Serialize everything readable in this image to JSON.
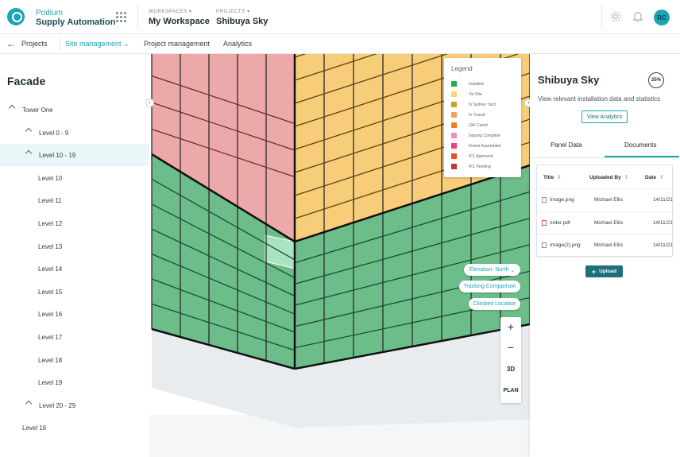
{
  "header": {
    "brand_small": "Podium",
    "brand_big": "Supply Automation",
    "workspaces_label": "WORKSPACES",
    "workspace_value": "My Workspace",
    "projects_label": "PROJECTS",
    "project_value": "Shibuya Sky",
    "avatar_initials": "RC",
    "icons": [
      "grid-icon",
      "gear-icon",
      "bell-icon"
    ]
  },
  "subnav": {
    "back_label": "Projects",
    "items": [
      "Site management",
      "Project management",
      "Analytics"
    ],
    "active_index": 0
  },
  "sidebar": {
    "title": "Facade",
    "tree": [
      {
        "label": "Tower One",
        "expanded": true,
        "indent": 0
      },
      {
        "label": "Level 0 - 9",
        "expanded": true,
        "indent": 1
      },
      {
        "label": "Level 10 - 19",
        "expanded": true,
        "indent": 1,
        "selected": true
      },
      {
        "label": "Level 10",
        "indent": 2
      },
      {
        "label": "Level 11",
        "indent": 2
      },
      {
        "label": "Level 12",
        "indent": 2
      },
      {
        "label": "Level 13",
        "indent": 2
      },
      {
        "label": "Level 14",
        "indent": 2
      },
      {
        "label": "Level 15",
        "indent": 2
      },
      {
        "label": "Level 16",
        "indent": 2
      },
      {
        "label": "Level 17",
        "indent": 2
      },
      {
        "label": "Level 18",
        "indent": 2
      },
      {
        "label": "Level 19",
        "indent": 2
      },
      {
        "label": "Level 20 - 29",
        "expanded": true,
        "indent": 1
      },
      {
        "label": "Level 16",
        "indent": 3
      }
    ]
  },
  "legend": {
    "title": "Legend",
    "items": [
      {
        "label": "Installed",
        "color": "#22b14c"
      },
      {
        "label": "On Site",
        "color": "#f7d774"
      },
      {
        "label": "In Sydney Yard",
        "color": "#c9a227"
      },
      {
        "label": "In Transit",
        "color": "#f2a25c"
      },
      {
        "label": "QA/ Cured",
        "color": "#f47a1f"
      },
      {
        "label": "Glazing Complete",
        "color": "#f08ac0"
      },
      {
        "label": "Frame Assembled",
        "color": "#e8457a"
      },
      {
        "label": "IFC Approved",
        "color": "#f04e23"
      },
      {
        "label": "IFC Pending",
        "color": "#c0392b"
      }
    ]
  },
  "canvas_controls": {
    "elevation": "Elevation: North",
    "tracking": "Tracking Comparison",
    "climbed": "Climbed Location",
    "zoom_in": "+",
    "zoom_out": "−",
    "view_3d": "3D",
    "view_plan": "PLAN"
  },
  "panel": {
    "title": "Shibuya Sky",
    "percent": "25%",
    "description": "View relevant installation data and statistics",
    "analytics_button": "View Analytics",
    "tabs": [
      "Panel Data",
      "Documents"
    ],
    "active_tab": 1,
    "columns": [
      "Title",
      "Uploaded By",
      "Date"
    ],
    "rows": [
      {
        "title": "Image.png",
        "by": "Michael Ellis",
        "date": "14/11/21",
        "kind": "image"
      },
      {
        "title": "order.pdf",
        "by": "Michael Ellis",
        "date": "14/11/21",
        "kind": "pdf"
      },
      {
        "title": "Image(2).png",
        "by": "Michael Ellis",
        "date": "14/11/21",
        "kind": "image"
      }
    ],
    "upload_button": "Upload"
  },
  "colors": {
    "accent": "#1aa5b5",
    "installed": "#6cbd8a",
    "on_site": "#f8cd7a",
    "frame": "#eda9a9",
    "highlight": "#a9e3c1"
  }
}
